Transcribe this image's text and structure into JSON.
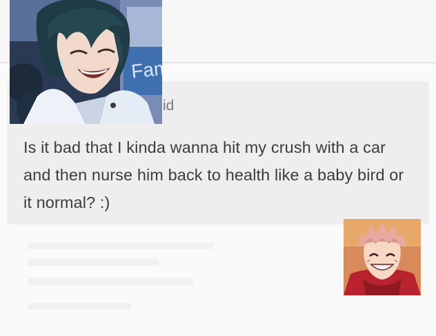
{
  "post": {
    "asker_fragment": "id",
    "question": "Is it bad that I kinda wanna hit my crush with a car and then nurse him back to health like a baby bird or it normal? :)"
  },
  "photo1": {
    "sign_text": "Fam"
  }
}
